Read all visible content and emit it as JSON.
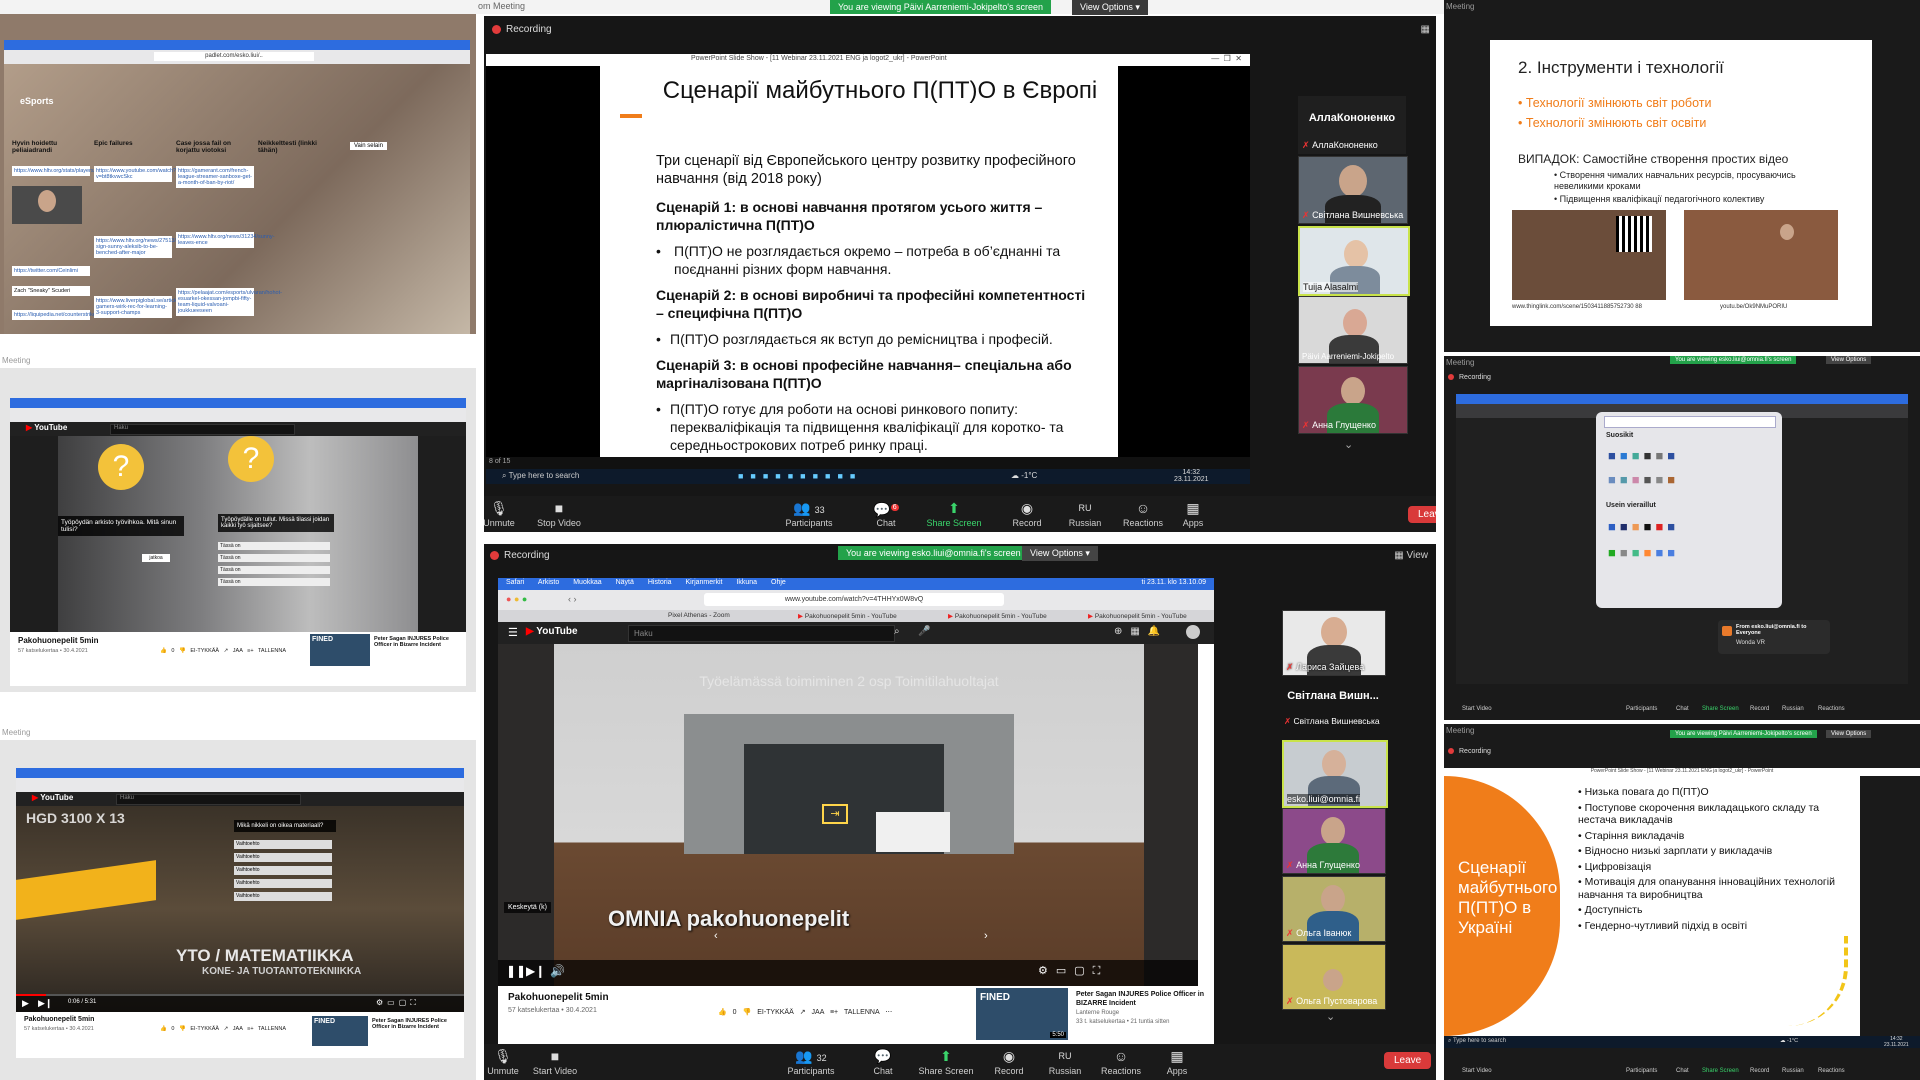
{
  "top_window": {
    "title": "om Meeting",
    "banner": "You are viewing Päivi Aarreniemi-Jokipelto's screen",
    "view_options": "View Options ▾"
  },
  "tile_center_top": {
    "recording": "Recording",
    "ppt_title": "PowerPoint Slide Show - [11 Webinar 23.11.2021 ENG ja logot2_ukr] - PowerPoint",
    "slide": {
      "title": "Сценарії майбутнього П(ПТ)О в Європі",
      "intro": "Три сценарії від Європейського центру розвитку професійного навчання (від 2018 року)",
      "s1_head": "Сценарій 1: в основі навчання протягом усього життя – плюралістична П(ПТ)О",
      "s1_bullet": "П(ПТ)О не розглядається окремо – потреба в об’єднанні та поєднанні різних форм навчання.",
      "s2_head": "Сценарій 2: в основі виробничі та професійні компетентності – специфічна П(ПТ)О",
      "s2_bullet": "П(ПТ)О розглядається як вступ до ремісництва і професій.",
      "s3_head": "Сценарій 3: в основі професійне навчання– спеціальна або маргіналізована П(ПТ)О",
      "s3_bullet": "П(ПТ)О готує для роботи на основі ринкового попиту: перекваліфікація та підвищення кваліфікації для коротко- та середньострокових потреб ринку праці."
    },
    "slide_counter": "8 of 15",
    "search_placeholder": "Type here to search",
    "weather": "-1°C",
    "time": "14:32",
    "date": "23.11.2021",
    "participants_panel": {
      "name_header": "АллаКононенко",
      "name_label": "АллаКононенко",
      "people": [
        "Світлана Вишневська",
        "Tuija Alasalmi",
        "Päivi Aarreniemi-Jokipelto",
        "Анна Глущенко"
      ]
    },
    "toolbar": {
      "unmute": "Unmute",
      "stop_video": "Stop Video",
      "participants": "Participants",
      "participants_count": "33",
      "chat": "Chat",
      "chat_badge": "6",
      "share": "Share Screen",
      "record": "Record",
      "lang_code": "RU",
      "language": "Russian",
      "reactions": "Reactions",
      "apps": "Apps",
      "leave": "Leave"
    }
  },
  "tile_center_bottom": {
    "recording": "Recording",
    "banner": "You are viewing esko.liui@omnia.fi's screen",
    "view_options": "View Options ▾",
    "view": "View",
    "menubar": [
      "Safari",
      "Arkisto",
      "Muokkaa",
      "Näytä",
      "Historia",
      "Kirjanmerkit",
      "Ikkuna",
      "Ohje"
    ],
    "menubar_clock": "ti 23.11. klo 13.10.09",
    "url": "www.youtube.com/watch?v=4THHYx0W8vQ",
    "tabs": [
      "Pixel Athenas - Zoom",
      "Pakohuonepelit 5min - YouTube",
      "Pakohuonepelit 5min - YouTube",
      "Pakohuonepelit 5min - YouTube"
    ],
    "yt_search": "Haku",
    "video_overlay_top": "Työelämässä toimiminen 2 osp Toimitilahuoltajat",
    "video_caption": "OMNIA pakohuonepelit",
    "pause_hint": "Keskeytä (k)",
    "video_title": "Pakohuonepelit 5min",
    "video_meta": "57 katselukertaa • 30.4.2021",
    "likes": "0",
    "dislike": "EI-TYKKÄÄ",
    "share": "JAA",
    "save": "TALLENNA",
    "rec_title": "Peter Sagan INJURES Police Officer in BIZARRE Incident",
    "rec_channel": "Lanterne Rouge",
    "rec_meta": "33 t. katselukertaa • 21 tuntia sitten",
    "rec_badge": "FINED",
    "rec_duration": "5:50",
    "people": [
      "Лариса Зайцева",
      "Світлана Вишневська",
      "esko.liui@omnia.fi",
      "Анна Глущенко",
      "Ольга Іванюк",
      "Ольга Пустоварова"
    ],
    "name_header": "Світлана Вишн...",
    "toolbar": {
      "unmute": "Unmute",
      "start_video": "Start Video",
      "participants": "Participants",
      "participants_count": "32",
      "chat": "Chat",
      "share": "Share Screen",
      "record": "Record",
      "lang_code": "RU",
      "language": "Russian",
      "reactions": "Reactions",
      "apps": "Apps",
      "leave": "Leave"
    }
  },
  "tile_left_top": {
    "url": "padlet.com/esko.liui/..",
    "board_title": "eSports",
    "cols": [
      "Hyvin hoidettu peliaiadrandi",
      "Epic failures",
      "Case jossa fail on korjattu viotoksi",
      "Neikkelttesti (linkki tähän)"
    ],
    "links": [
      "https://www.hltv.org/stats/players/7592/device?",
      "https://www.youtube.com/watch?v=bt8tkvwcSkc",
      "https://gamerant.com/french-league-streamer-sanboxe-get-a-month-of-ban-by-riot/",
      "https://twitter.com/Ceinlimi",
      "https://www.hltv.org/news/27513/anze-sign-sunny-aleksib-to-be-benched-after-major",
      "https://www.hltv.org/news/31234/sunny-leaves-ence",
      "Zach \"Sneaky\" Scuderi",
      "https://liquipedia.net/counterstrike/Fe.ruRelax",
      "https://www.liverpiglobal.se/articles/7335/nh-gamers-wirk-rec-for-learning-3-support-champs",
      "https://pelaajat.com/esports/ulvaran/hohot-esuarkel-okessan-jompbi-fifty-team-liquid-valvoani-joukkueeseen"
    ],
    "badge": "Vain selain"
  },
  "tile_left_mid": {
    "video_title": "Pakohuonepelit 5min",
    "video_meta": "57 katselukertaa • 30.4.2021",
    "q1": "Työpöydän arkisto työvihkoa. Mitä sinun tulisi?",
    "q2": "Työpöydälle on tullut. Missä tilassi joidan kaikki työ sijaitsee?",
    "rec_title": "Peter Sagan INJURES Police Officer in Bizarre Incident",
    "yt_search": "Haku",
    "likes": "0",
    "dislike": "EI-TYKKÄÄ",
    "share": "JAA",
    "save": "TALLENNA",
    "rec_badge": "FINED",
    "option_prefix": "Tässä on",
    "small_btn": "jatkoa"
  },
  "tile_left_bottom": {
    "video_title": "Pakohuonepelit 5min",
    "video_meta": "57 katselukertaa • 30.4.2021",
    "overlay_q": "Mikä nikkeli on oikea materiaali?",
    "caption1": "YTO / MATEMATIIKKA",
    "caption2": "KONE- JA TUOTANTOTEKNIIKKA",
    "machine_text": "HGD 3100 X 13",
    "yt_search": "Haku",
    "likes": "0",
    "dislike": "EI-TYKKÄÄ",
    "share": "JAA",
    "save": "TALLENNA",
    "rec_title": "Peter Sagan INJURES Police Officer in Bizarre Incident",
    "rec_badge": "FINED",
    "option_text": "Vaihtoehto",
    "time": "0:06 / 5:31"
  },
  "tile_right_top": {
    "title": "2. Інструменти і технології",
    "b1": "Технології змінюють світ роботи",
    "b2": "Технології змінюють світ освіти",
    "case": "ВИПАДОК: Самостійне створення простих відео",
    "sub1": "Створення чималих навчальних ресурсів, просуваючись невеликими кроками",
    "sub2": "Підвищення кваліфікації педагогічного колективу",
    "link1": "www.thinglink.com/scene/1503411885752730 88",
    "link2": "youtu.be/Ok9NMuPORIU",
    "label": "Meeting"
  },
  "tile_right_mid": {
    "label": "Meeting",
    "banner": "You are viewing esko.liui@omnia.fi's screen",
    "view_options": "View Options",
    "recording": "Recording",
    "favorites": "Suosikit",
    "frequent": "Usein vieraillut",
    "chat_from": "From esko.liui@omnia.fi to Everyone",
    "chat_msg": "Wonda VR",
    "start_video": "Start Video",
    "participants": "Participants",
    "chat": "Chat",
    "share": "Share Screen",
    "record": "Record",
    "language": "Russian",
    "reactions": "Reactions"
  },
  "tile_right_bottom": {
    "label": "Meeting",
    "banner": "You are viewing Päivi Aarreniemi-Jokipelto's screen",
    "view_options": "View Options",
    "recording": "Recording",
    "ppt_title": "PowerPoint Slide Show - [11 Webinar 23.11.2021 ENG ja logot2_ukr] - PowerPoint",
    "orange_title": "Сценарії майбутнього П(ПТ)О в Україні",
    "bullets": [
      "Низька повага до П(ПТ)О",
      "Поступове скорочення викладацького складу та нестача викладачів",
      "Старіння викладачів",
      "Відносно низькі зарплати у викладачів",
      "Цифровізація",
      "Мотивація для опанування інноваційних технологій навчання та виробництва",
      "Доступність",
      "Гендерно-чутливий підхід в освіті"
    ],
    "search_placeholder": "Type here to search",
    "start_video": "Start Video",
    "participants": "Participants",
    "chat": "Chat",
    "share": "Share Screen",
    "record": "Record",
    "language": "Russian",
    "reactions": "Reactions",
    "weather": "-1°C",
    "time": "14:32",
    "date": "23.11.2021"
  },
  "left_labels": {
    "mid": "Meeting",
    "bottom": "Meeting"
  },
  "colors": {
    "accent_green": "#23a24a",
    "leave_red": "#d93a3a",
    "slide_orange": "#f07d1a",
    "zoom_black": "#1a1a1a",
    "active_speaker": "#c9e34a"
  }
}
